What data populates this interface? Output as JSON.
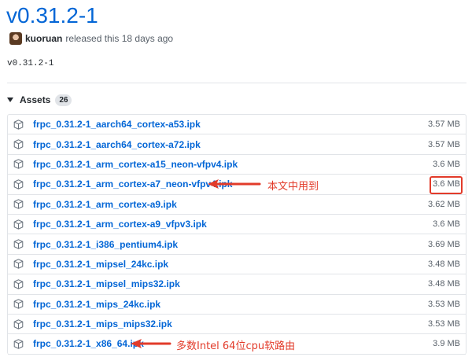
{
  "release": {
    "title": "v0.31.2-1",
    "author": "kuoruan",
    "meta_text": "released this 18 days ago",
    "tag_body": "v0.31.2-1"
  },
  "assets": {
    "label": "Assets",
    "count": "26",
    "items": [
      {
        "name": "frpc_0.31.2-1_aarch64_cortex-a53.ipk",
        "size": "3.57 MB"
      },
      {
        "name": "frpc_0.31.2-1_aarch64_cortex-a72.ipk",
        "size": "3.57 MB"
      },
      {
        "name": "frpc_0.31.2-1_arm_cortex-a15_neon-vfpv4.ipk",
        "size": "3.6 MB"
      },
      {
        "name": "frpc_0.31.2-1_arm_cortex-a7_neon-vfpv4.ipk",
        "size": "3.6 MB"
      },
      {
        "name": "frpc_0.31.2-1_arm_cortex-a9.ipk",
        "size": "3.62 MB"
      },
      {
        "name": "frpc_0.31.2-1_arm_cortex-a9_vfpv3.ipk",
        "size": "3.6 MB"
      },
      {
        "name": "frpc_0.31.2-1_i386_pentium4.ipk",
        "size": "3.69 MB"
      },
      {
        "name": "frpc_0.31.2-1_mipsel_24kc.ipk",
        "size": "3.48 MB"
      },
      {
        "name": "frpc_0.31.2-1_mipsel_mips32.ipk",
        "size": "3.48 MB"
      },
      {
        "name": "frpc_0.31.2-1_mips_24kc.ipk",
        "size": "3.53 MB"
      },
      {
        "name": "frpc_0.31.2-1_mips_mips32.ipk",
        "size": "3.53 MB"
      },
      {
        "name": "frpc_0.31.2-1_x86_64.ipk",
        "size": "3.9 MB"
      }
    ]
  },
  "annotations": {
    "used_in_article": "本文中用到",
    "x86_note": "多数Intel 64位cpu软路由"
  },
  "colors": {
    "link": "#0366d6",
    "annotation": "#e23b2a",
    "border": "#e1e4e8"
  },
  "icons": {
    "asset": "package-icon"
  }
}
